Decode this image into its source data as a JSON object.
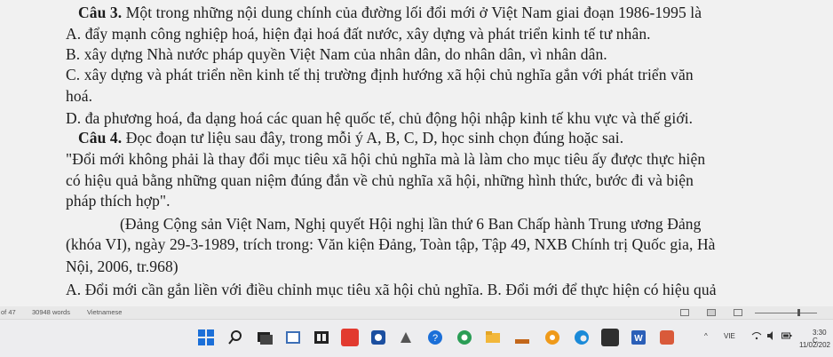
{
  "document": {
    "lines": [
      {
        "id": "q3-title",
        "bold_prefix": "Câu 3.",
        "text": " Một trong những nội dung chính của đường lối đổi mới ở Việt Nam giai đoạn 1986-1995 là"
      },
      {
        "id": "q3-a",
        "bold_prefix": "",
        "text": "A. đẩy mạnh công nghiệp hoá, hiện đại hoá đất nước, xây dựng và phát triển kinh tế tư nhân."
      },
      {
        "id": "q3-b",
        "bold_prefix": "",
        "text": "B. xây dựng Nhà nước pháp quyền Việt Nam của nhân dân, do nhân dân, vì nhân dân."
      },
      {
        "id": "q3-c1",
        "bold_prefix": "",
        "text": "C. xây dựng và phát triển nền kinh tế thị trường định hướng xã hội chủ nghĩa gắn với phát triển văn"
      },
      {
        "id": "q3-c2",
        "bold_prefix": "",
        "text": "hoá."
      },
      {
        "id": "q3-d",
        "bold_prefix": "",
        "text": "D. đa phương hoá, đa dạng hoá các quan hệ quốc tế, chủ động hội nhập kinh tế khu vực và thế giới."
      },
      {
        "id": "q4-title",
        "bold_prefix": "Câu 4.",
        "text": " Đọc đoạn tư liệu sau đây, trong mỗi ý A, B, C, D, học sinh chọn đúng hoặc sai."
      },
      {
        "id": "q4-quote1",
        "bold_prefix": "",
        "text": "\"Đổi mới không phải là thay đổi mục tiêu xã hội chủ nghĩa mà là làm cho mục tiêu ấy được thực hiện"
      },
      {
        "id": "q4-quote2",
        "bold_prefix": "",
        "text": "có hiệu quả bằng những quan niệm đúng đắn về chủ nghĩa xã hội, những hình thức, bước đi và biện"
      },
      {
        "id": "q4-quote3",
        "bold_prefix": "",
        "text": "pháp thích hợp\"."
      },
      {
        "id": "q4-src1",
        "bold_prefix": "",
        "text": "(Đảng Cộng sản Việt Nam, Nghị quyết Hội nghị lần thứ 6 Ban Chấp hành Trung ương Đảng"
      },
      {
        "id": "q4-src2",
        "bold_prefix": "",
        "text": "(khóa VI), ngày 29-3-1989, trích trong: Văn kiện Đảng, Toàn tập, Tập 49, NXB Chính trị Quốc gia, Hà"
      },
      {
        "id": "q4-src3",
        "bold_prefix": "",
        "text": "Nội, 2006, tr.968)"
      },
      {
        "id": "q4-ab",
        "bold_prefix": "",
        "text": "A. Đổi mới cần gắn liền với điều chỉnh mục tiêu xã hội chủ nghĩa. B. Đổi mới để thực hiện có hiệu quả"
      }
    ]
  },
  "status_bar": {
    "page_count": "of 47",
    "word_count": "30948 words",
    "language": "Vietnamese"
  },
  "taskbar": {
    "apps": [
      "windows-start-icon",
      "search-icon",
      "task-view-icon",
      "file-explorer-icon",
      "widgets-icon",
      "app-icon",
      "app-icon",
      "help-icon",
      "chrome-icon",
      "folder-icon",
      "app-icon",
      "edge-icon",
      "app-icon",
      "word-icon",
      "app-icon"
    ],
    "language_indicator": "VIE",
    "time": "3:30 C",
    "date": "11/02/202"
  },
  "colors": {
    "page_bg": "#f1f1f1",
    "text": "#1d1d1d",
    "taskbar_bg": "#ededef",
    "statusbar_bg": "#e8e8e8"
  }
}
